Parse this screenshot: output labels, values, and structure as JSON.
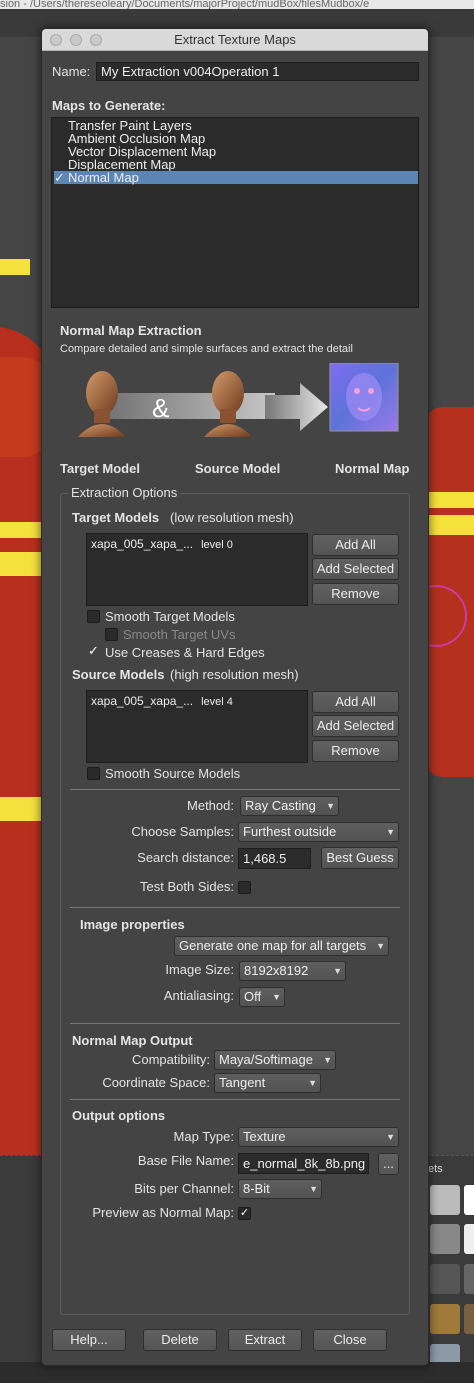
{
  "background": {
    "path_text": "sion - /Users/thereseoleary/Documents/majorProject/mudBox/filesMudbox/e",
    "tray_label": "ets"
  },
  "dialog": {
    "title": "Extract Texture Maps",
    "name_label": "Name:",
    "name_value": "My Extraction v004Operation 1",
    "maps_label": "Maps to Generate:",
    "maps": [
      {
        "label": "Transfer Paint Layers",
        "checked": false
      },
      {
        "label": "Ambient Occlusion Map",
        "checked": false
      },
      {
        "label": "Vector Displacement Map",
        "checked": false
      },
      {
        "label": "Displacement Map",
        "checked": false
      },
      {
        "label": "Normal Map",
        "checked": true
      }
    ],
    "check_mark": "✓",
    "extraction": {
      "heading": "Normal Map Extraction",
      "description": "Compare detailed and simple surfaces and extract the detail",
      "target_caption": "Target Model",
      "source_caption": "Source Model",
      "result_caption": "Normal Map",
      "ampersand": "&"
    },
    "options_title": "Extraction Options",
    "target": {
      "heading": "Target Models",
      "hint": "(low resolution mesh)",
      "mesh_name": "xapa_005_xapa_...",
      "mesh_level": "level 0",
      "add_all": "Add All",
      "add_selected": "Add Selected",
      "remove": "Remove",
      "smooth_models": "Smooth Target Models",
      "smooth_uvs": "Smooth Target UVs",
      "use_creases": "Use Creases & Hard Edges"
    },
    "source": {
      "heading": "Source Models",
      "hint": "(high resolution mesh)",
      "mesh_name": "xapa_005_xapa_...",
      "mesh_level": "level 4",
      "add_all": "Add All",
      "add_selected": "Add Selected",
      "remove": "Remove",
      "smooth_models": "Smooth Source Models"
    },
    "method": {
      "method_label": "Method:",
      "method_value": "Ray Casting",
      "samples_label": "Choose Samples:",
      "samples_value": "Furthest outside",
      "distance_label": "Search distance:",
      "distance_value": "1,468.5",
      "best_guess": "Best Guess",
      "both_sides_label": "Test Both Sides:"
    },
    "image": {
      "heading": "Image properties",
      "generate_value": "Generate one map for all targets",
      "size_label": "Image Size:",
      "size_value": "8192x8192",
      "aa_label": "Antialiasing:",
      "aa_value": "Off"
    },
    "nm_output": {
      "heading": "Normal Map Output",
      "compat_label": "Compatibility:",
      "compat_value": "Maya/Softimage",
      "coord_label": "Coordinate Space:",
      "coord_value": "Tangent"
    },
    "output": {
      "heading": "Output options",
      "map_type_label": "Map Type:",
      "map_type_value": "Texture",
      "base_file_label": "Base File Name:",
      "base_file_value": "e_normal_8k_8b.png",
      "browse": "...",
      "bits_label": "Bits per Channel:",
      "bits_value": "8-Bit",
      "preview_label": "Preview as Normal Map:"
    },
    "buttons": {
      "help": "Help...",
      "delete": "Delete",
      "extract": "Extract",
      "close": "Close"
    }
  },
  "colors": {
    "selection": "#5b86b3",
    "dialog_bg": "#444444",
    "field_bg": "#2b2b2b"
  }
}
